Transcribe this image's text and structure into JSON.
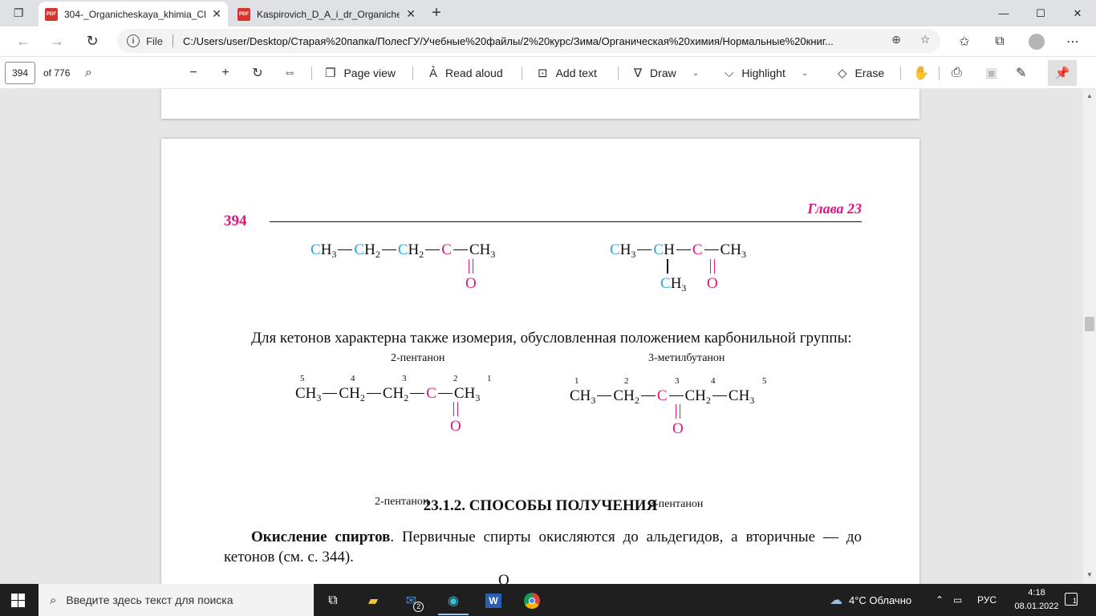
{
  "browser": {
    "tabs": [
      {
        "label": "304-_Organicheskaya_khimia_Ch",
        "active": true
      },
      {
        "label": "Kaspirovich_D_A_i_dr_Organiche",
        "active": false
      }
    ],
    "address": {
      "scheme_label": "File",
      "url": "C:/Users/user/Desktop/Старая%20папка/ПолесГУ/Учебные%20файлы/2%20курс/Зима/Органическая%20химия/Нормальные%20книг..."
    },
    "window_controls": {
      "minimize": "—",
      "maximize": "☐",
      "close": "✕"
    }
  },
  "pdf_toolbar": {
    "page_number": "394",
    "page_of": "of 776",
    "page_view": "Page view",
    "read_aloud": "Read aloud",
    "add_text": "Add text",
    "draw": "Draw",
    "highlight": "Highlight",
    "erase": "Erase"
  },
  "document": {
    "page_num": "394",
    "chapter": "Глава 23",
    "captions": {
      "pentanone2_top": "2-пентанон",
      "methylbutanone": "3-метилбутанон",
      "pentanone2_bottom": "2-пентанон",
      "pentanone3": "3-пентанон"
    },
    "paragraph1": "Для кетонов характерна также изомерия, обусловленная положением карбонильной группы:",
    "section_title": "23.1.2. СПОСОБЫ ПОЛУЧЕНИЯ",
    "paragraph2_bold": "Окисление спиртов",
    "paragraph2_rest": ". Первичные спирты окисляются до альдегидов, а вторичные — до кетонов (см. с. 344).",
    "trailing_letter": "O"
  },
  "taskbar": {
    "search_placeholder": "Введите здесь текст для поиска",
    "mail_badge": "2",
    "weather": "4°C  Облачно",
    "language": "РУС",
    "time": "4:18",
    "date": "08.01.2022",
    "notification_count": "1"
  },
  "colors": {
    "accent_pink": "#e0157e",
    "accent_blue": "#2aa6e0",
    "pdf_red": "#d9342b"
  }
}
